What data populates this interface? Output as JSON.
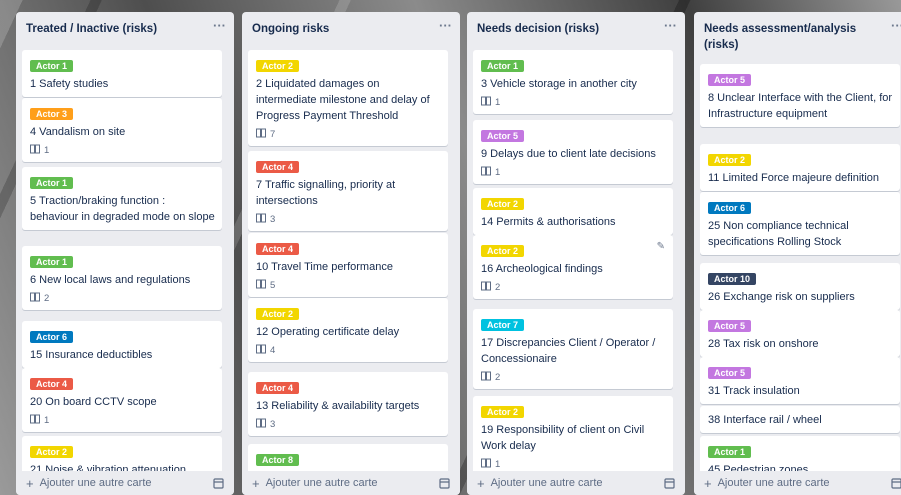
{
  "menu_glyph": "···",
  "add_card_label": "Ajouter une autre carte",
  "add_card_plus": "+",
  "label_colors": {
    "green": "#61bd4f",
    "orange": "#ff9f1a",
    "yellow": "#f2d600",
    "red": "#eb5a46",
    "blue": "#0079bf",
    "purple": "#c377e0",
    "teal": "#00c2e0",
    "navy": "#344563"
  },
  "lists": [
    {
      "title": "Treated / Inactive (risks)",
      "cards": [
        {
          "label": "Actor 1",
          "color": "green",
          "title": "1 Safety studies"
        },
        {
          "label": "Actor 3",
          "color": "orange",
          "title": "4 Vandalism on site",
          "attachments": "1"
        },
        {
          "label": "Actor 1",
          "color": "green",
          "title": "5 Traction/braking function : behaviour in degraded mode on slope"
        },
        {
          "label": "Actor 1",
          "color": "green",
          "title": "6 New local laws and regulations",
          "attachments": "2"
        },
        {
          "label": "Actor 6",
          "color": "blue",
          "title": "15 Insurance deductibles"
        },
        {
          "label": "Actor 4",
          "color": "red",
          "title": "20 On board CCTV scope",
          "attachments": "1"
        },
        {
          "label": "Actor 2",
          "color": "yellow",
          "title": "21 Noise & vibration attenuation"
        }
      ]
    },
    {
      "title": "Ongoing risks",
      "cards": [
        {
          "label": "Actor 2",
          "color": "yellow",
          "title": "2 Liquidated damages on intermediate milestone and delay of Progress Payment Threshold",
          "attachments": "7"
        },
        {
          "label": "Actor 4",
          "color": "red",
          "title": "7 Traffic signalling, priority at intersections",
          "attachments": "3"
        },
        {
          "label": "Actor 4",
          "color": "red",
          "title": "10 Travel Time performance",
          "attachments": "5"
        },
        {
          "label": "Actor 2",
          "color": "yellow",
          "title": "12 Operating certificate delay",
          "attachments": "4"
        },
        {
          "label": "Actor 4",
          "color": "red",
          "title": "13 Reliability & availability targets",
          "attachments": "3"
        },
        {
          "label": "Actor 8",
          "color": "green",
          "title": ""
        }
      ]
    },
    {
      "title": "Needs decision (risks)",
      "cards": [
        {
          "label": "Actor 1",
          "color": "green",
          "title": "3 Vehicle storage in another city",
          "attachments": "1"
        },
        {
          "label": "Actor 5",
          "color": "purple",
          "title": "9 Delays due to client late decisions",
          "attachments": "1"
        },
        {
          "label": "Actor 2",
          "color": "yellow",
          "title": "14 Permits & authorisations"
        },
        {
          "label": "Actor 2",
          "color": "yellow",
          "title": "16 Archeological findings",
          "attachments": "2",
          "editing": true
        },
        {
          "label": "Actor 7",
          "color": "teal",
          "title": "17 Discrepancies Client / Operator / Concessionaire",
          "attachments": "2"
        },
        {
          "label": "Actor 2",
          "color": "yellow",
          "title": "19 Responsibility of client on Civil Work delay",
          "attachments": "1"
        }
      ]
    },
    {
      "title": "Needs assessment/analysis (risks)",
      "cards": [
        {
          "label": "Actor 5",
          "color": "purple",
          "title": "8 Unclear Interface with the Client, for Infrastructure equipment"
        },
        {
          "label": "Actor 2",
          "color": "yellow",
          "title": "11 Limited Force majeure definition"
        },
        {
          "label": "Actor 6",
          "color": "blue",
          "title": "25 Non compliance technical specifications Rolling Stock"
        },
        {
          "label": "Actor 10",
          "color": "navy",
          "title": "26 Exchange risk on suppliers"
        },
        {
          "label": "Actor 5",
          "color": "purple",
          "title": "28 Tax risk on onshore"
        },
        {
          "label": "Actor 5",
          "color": "purple",
          "title": "31 Track insulation"
        },
        {
          "title": "38 Interface rail / wheel"
        },
        {
          "label": "Actor 1",
          "color": "green",
          "title": "45 Pedestrian zones"
        }
      ]
    }
  ]
}
